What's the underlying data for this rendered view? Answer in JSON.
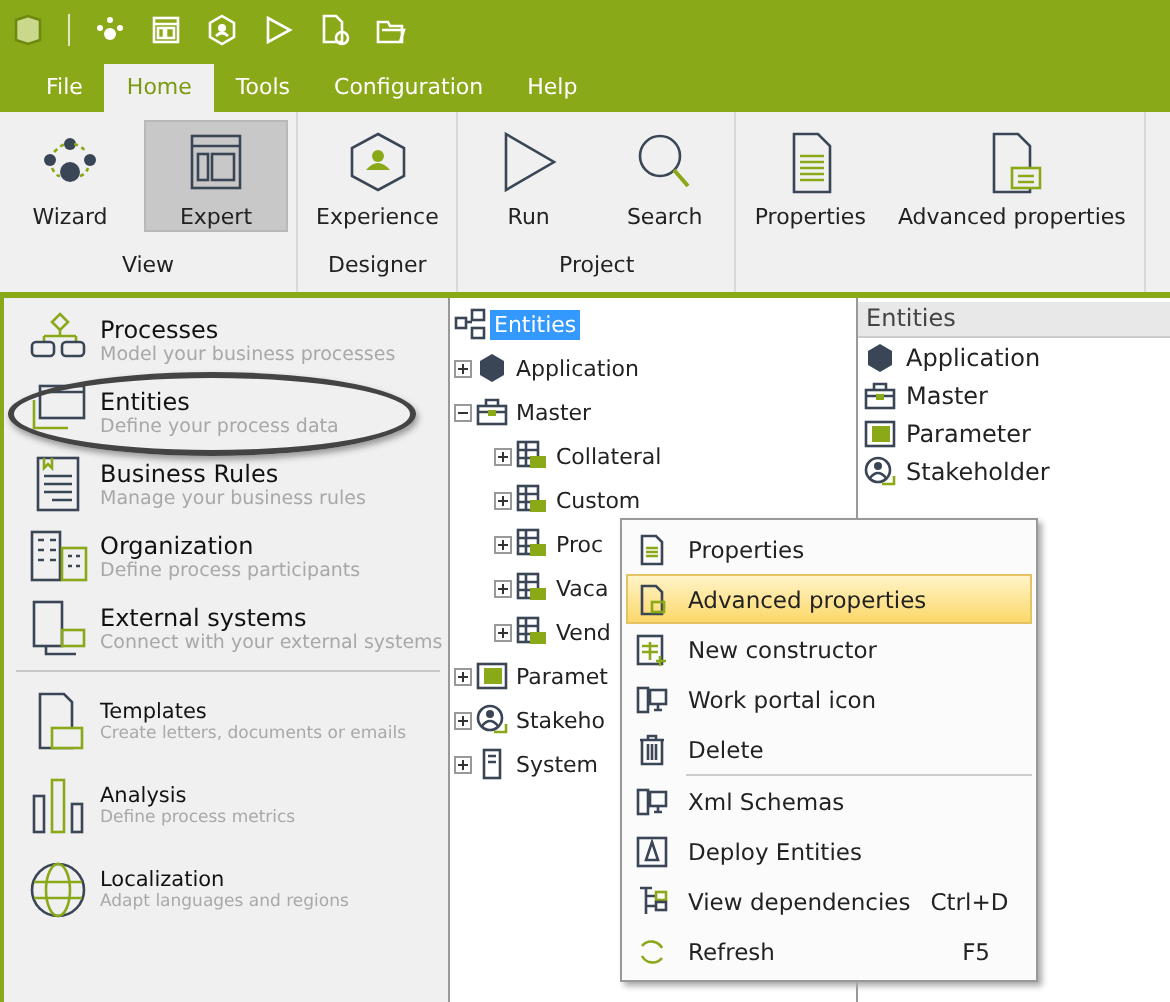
{
  "menu_tabs": [
    {
      "label": "File",
      "selected": false
    },
    {
      "label": "Home",
      "selected": true
    },
    {
      "label": "Tools",
      "selected": false
    },
    {
      "label": "Configuration",
      "selected": false
    },
    {
      "label": "Help",
      "selected": false
    }
  ],
  "ribbon": [
    {
      "label": "View",
      "buttons": [
        {
          "label": "Wizard",
          "selected": false
        },
        {
          "label": "Expert",
          "selected": true
        }
      ]
    },
    {
      "label": "Designer",
      "buttons": [
        {
          "label": "Experience",
          "selected": false
        }
      ]
    },
    {
      "label": "Project",
      "buttons": [
        {
          "label": "Run",
          "selected": false
        },
        {
          "label": "Search",
          "selected": false
        }
      ]
    },
    {
      "buttons": [
        {
          "label": "Properties",
          "selected": false
        },
        {
          "label": "Advanced properties",
          "selected": false
        }
      ]
    }
  ],
  "sidebar": {
    "sections": [
      [
        {
          "title": "Processes",
          "description": "Model your business processes",
          "circled": false
        },
        {
          "title": "Entities",
          "description": "Define your process data",
          "circled": true
        },
        {
          "title": "Business Rules",
          "description": "Manage your business rules",
          "circled": false
        },
        {
          "title": "Organization",
          "description": "Define process participants",
          "circled": false
        },
        {
          "title": "External systems",
          "description": "Connect with your external systems",
          "circled": false
        }
      ],
      [
        {
          "title": "Templates",
          "description": "Create letters, documents  or emails",
          "circled": false
        },
        {
          "title": "Analysis",
          "description": "Define  process  metrics",
          "circled": false
        },
        {
          "title": "Localization",
          "description": "Adapt  languages  and regions",
          "circled": false
        }
      ]
    ]
  },
  "tree": {
    "label": "Entities",
    "selected": true,
    "children": [
      {
        "label": "Application",
        "selected": false,
        "expanded": false
      },
      {
        "label": "Master",
        "selected": false,
        "expanded": true,
        "children": [
          {
            "label": "Collateral",
            "selected": false,
            "expanded": false
          },
          {
            "label": "Custom",
            "selected": false,
            "expanded": false
          },
          {
            "label": "Proc",
            "selected": false,
            "expanded": false
          },
          {
            "label": "Vaca",
            "selected": false,
            "expanded": false
          },
          {
            "label": "Vend",
            "selected": false,
            "expanded": false
          }
        ]
      },
      {
        "label": "Paramet",
        "selected": false,
        "expanded": false
      },
      {
        "label": "Stakeho",
        "selected": false,
        "expanded": false
      },
      {
        "label": "System",
        "selected": false,
        "expanded": false
      }
    ]
  },
  "list": {
    "header": "Entities",
    "items": [
      "Application",
      "Master",
      "Parameter",
      "Stakeholder"
    ]
  },
  "context_menu": {
    "groups": [
      [
        {
          "label": "Properties",
          "selected": false
        },
        {
          "label": "Advanced properties",
          "selected": true
        },
        {
          "label": "New constructor",
          "selected": false
        },
        {
          "label": "Work portal icon",
          "selected": false
        },
        {
          "label": "Delete",
          "selected": false
        }
      ],
      [
        {
          "label": "Xml Schemas",
          "selected": false
        },
        {
          "label": "Deploy Entities",
          "selected": false
        },
        {
          "label": "View dependencies",
          "shortcut": "Ctrl+D",
          "selected": false
        },
        {
          "label": "Refresh",
          "shortcut": "F5",
          "selected": false
        }
      ]
    ]
  }
}
